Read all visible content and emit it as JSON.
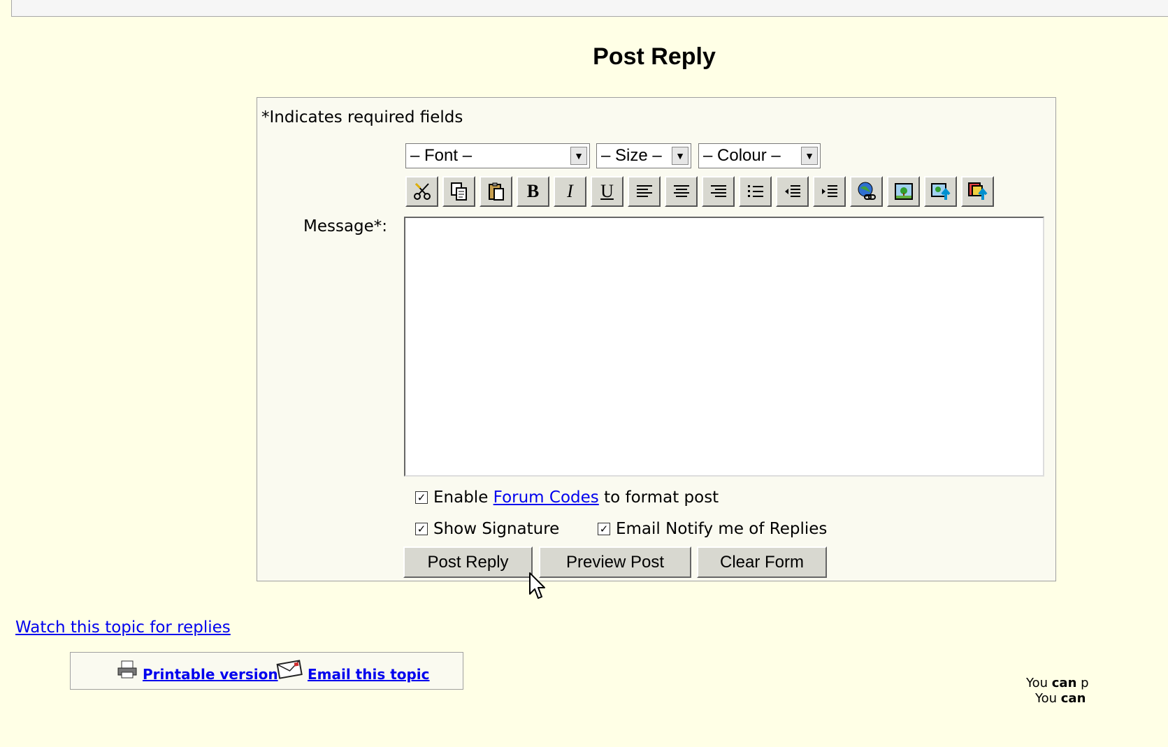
{
  "page": {
    "title": "Post Reply"
  },
  "form": {
    "required_note": "*Indicates required fields",
    "font_select": "– Font –",
    "size_select": "– Size –",
    "colour_select": "– Colour –",
    "message_label": "Message*:",
    "message_value": "",
    "enable_prefix": "Enable",
    "forum_codes_link": "Forum Codes",
    "enable_suffix": "to format post",
    "show_signature": "Show Signature",
    "email_notify": "Email Notify me of Replies",
    "checks": {
      "enable_codes": true,
      "show_signature": true,
      "email_notify": true
    }
  },
  "buttons": {
    "post_reply": "Post Reply",
    "preview_post": "Preview Post",
    "clear_form": "Clear Form"
  },
  "toolbar": {
    "bold": "B",
    "italic": "I",
    "underline": "U",
    "icons": [
      "cut-icon",
      "copy-icon",
      "paste-icon",
      "bold-icon",
      "italic-icon",
      "underline-icon",
      "align-left-icon",
      "align-center-icon",
      "align-right-icon",
      "bullet-list-icon",
      "outdent-icon",
      "indent-icon",
      "insert-link-icon",
      "insert-image-icon",
      "upload-image-icon",
      "upload-file-icon"
    ]
  },
  "footer": {
    "watch_link": "Watch this topic for replies",
    "printable_link": "Printable version",
    "email_topic_link": "Email this topic",
    "perm_line1_a": "You ",
    "perm_line1_b": "can",
    "perm_line1_c": " p",
    "perm_line2_a": "You ",
    "perm_line2_b": "can"
  }
}
